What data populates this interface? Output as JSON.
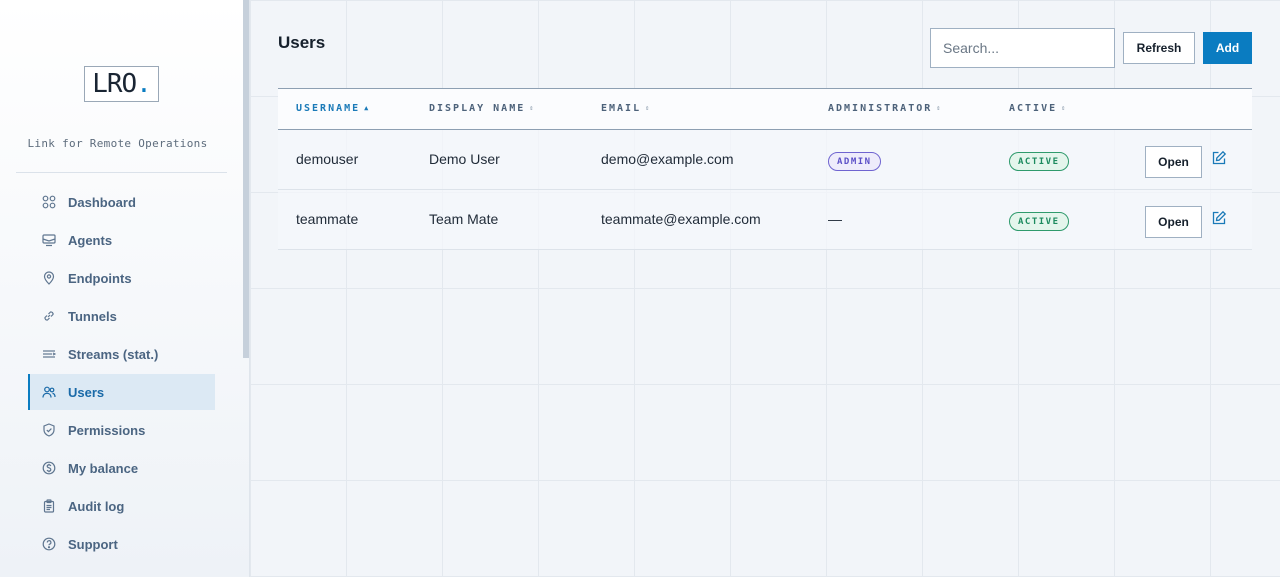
{
  "brand": {
    "logo_text": "LRO",
    "logo_dot": ".",
    "tagline": "Link for Remote Operations",
    "accent_color": "#0a7cc1"
  },
  "sidebar": {
    "items": [
      {
        "label": "Dashboard",
        "icon": "dashboard-icon"
      },
      {
        "label": "Agents",
        "icon": "agents-icon"
      },
      {
        "label": "Endpoints",
        "icon": "map-pin-icon"
      },
      {
        "label": "Tunnels",
        "icon": "link-icon"
      },
      {
        "label": "Streams (stat.)",
        "icon": "streams-icon"
      },
      {
        "label": "Users",
        "icon": "users-icon",
        "active": true
      },
      {
        "label": "Permissions",
        "icon": "shield-icon"
      },
      {
        "label": "My balance",
        "icon": "dollar-icon"
      },
      {
        "label": "Audit log",
        "icon": "clipboard-icon"
      },
      {
        "label": "Support",
        "icon": "help-icon"
      }
    ]
  },
  "page": {
    "title": "Users"
  },
  "toolbar": {
    "search_placeholder": "Search...",
    "refresh_label": "Refresh",
    "add_label": "Add"
  },
  "table": {
    "columns": [
      {
        "label": "USERNAME",
        "sorted": "asc"
      },
      {
        "label": "DISPLAY NAME"
      },
      {
        "label": "EMAIL"
      },
      {
        "label": "ADMINISTRATOR"
      },
      {
        "label": "ACTIVE"
      }
    ],
    "rows": [
      {
        "username": "demouser",
        "display_name": "Demo User",
        "email": "demo@example.com",
        "administrator": "ADMIN",
        "active": "ACTIVE",
        "open_label": "Open"
      },
      {
        "username": "teammate",
        "display_name": "Team Mate",
        "email": "teammate@example.com",
        "administrator": "—",
        "active": "ACTIVE",
        "open_label": "Open"
      }
    ]
  },
  "colors": {
    "primary": "#0a7cc1",
    "admin_badge": "#5b4fc7",
    "active_badge": "#1c8a5e"
  }
}
